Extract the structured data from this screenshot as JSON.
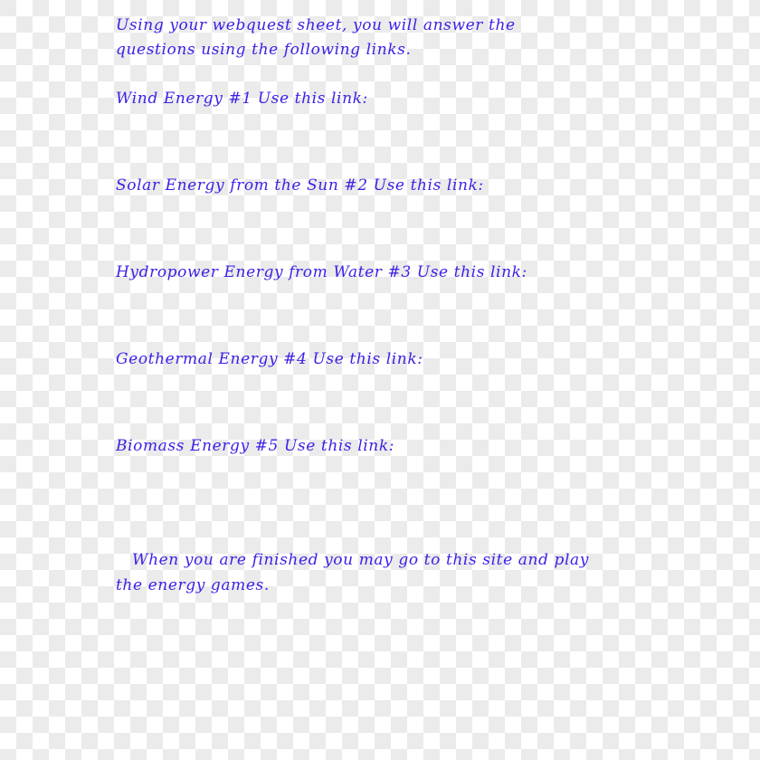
{
  "document": {
    "intro": [
      "Using your webquest sheet, you will answer the",
      "questions using the following links."
    ],
    "sections": [
      {
        "label": "Wind Energy #1 Use this link:"
      },
      {
        "label": "Solar Energy from the Sun #2 Use this link:"
      },
      {
        "label": "Hydropower Energy from Water #3  Use this link:"
      },
      {
        "label": "Geothermal Energy #4  Use this link:"
      },
      {
        "label": "Biomass Energy #5 Use this link:"
      }
    ],
    "closing": [
      "   When you are finished you may go to this site and play",
      "the energy games."
    ]
  },
  "colors": {
    "text": "#3a22e6",
    "checker_light": "#ffffff",
    "checker_dark": "#ebebeb"
  }
}
